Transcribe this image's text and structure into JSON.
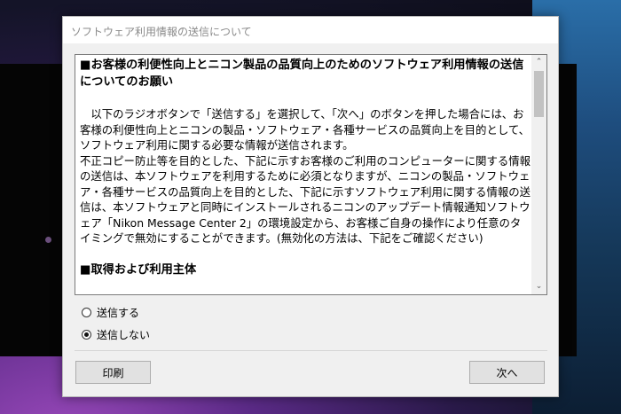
{
  "dialog": {
    "title": "ソフトウェア利用情報の送信について"
  },
  "content": {
    "heading": "■お客様の利便性向上とニコン製品の品質向上のためのソフトウェア利用情報の送信についてのお願い",
    "paragraph1": "　以下のラジオボタンで「送信する」を選択して、「次へ」のボタンを押した場合には、お客様の利便性向上とニコンの製品・ソフトウェア・各種サービスの品質向上を目的として、ソフトウェア利用に関する必要な情報が送信されます。",
    "paragraph2": "不正コピー防止等を目的とした、下記に示すお客様のご利用のコンピューターに関する情報の送信は、本ソフトウェアを利用するために必須となりますが、ニコンの製品・ソフトウェア・各種サービスの品質向上を目的とした、下記に示すソフトウェア利用に関する情報の送信は、本ソフトウェアと同時にインストールされるニコンのアップデート情報通知ソフトウェア「Nikon Message Center 2」の環境設定から、お客様ご自身の操作により任意のタイミングで無効にすることができます。(無効化の方法は、下記をご確認ください)",
    "heading2": "■取得および利用主体"
  },
  "scrollbar": {
    "up_arrow": "⌃",
    "down_arrow": "⌄"
  },
  "radios": {
    "send_label": "送信する",
    "dont_send_label": "送信しない",
    "selected": "dont_send"
  },
  "buttons": {
    "print_label": "印刷",
    "next_label": "次へ"
  }
}
